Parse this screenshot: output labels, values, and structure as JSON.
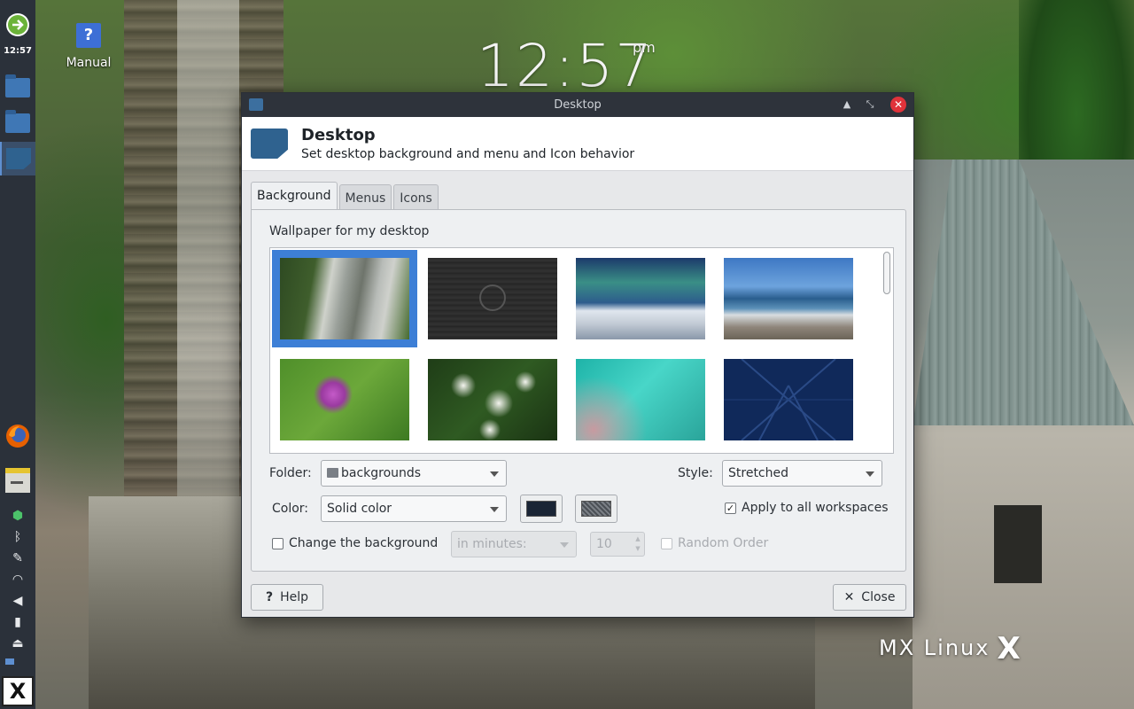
{
  "desktop": {
    "clock_time": "12:57",
    "clock_ampm": "pm",
    "icon_label": "Manual",
    "icon_glyph": "?",
    "watermark": "MX Linux",
    "watermark_mark": "X"
  },
  "panel": {
    "time": "12:57",
    "start_button": "X"
  },
  "window": {
    "title": "Desktop",
    "header_title": "Desktop",
    "header_subtitle": "Set desktop background and menu and Icon behavior",
    "tabs": [
      {
        "label": "Background",
        "active": true
      },
      {
        "label": "Menus",
        "active": false
      },
      {
        "label": "Icons",
        "active": false
      }
    ],
    "section_label": "Wallpaper for my desktop",
    "wallpapers": [
      {
        "name": "waterfall-mill",
        "selected": true
      },
      {
        "name": "dark-mx-logo",
        "selected": false
      },
      {
        "name": "aurora-mountain",
        "selected": false
      },
      {
        "name": "coast-beach",
        "selected": false
      },
      {
        "name": "bee-thistle",
        "selected": false
      },
      {
        "name": "white-flowers",
        "selected": false
      },
      {
        "name": "dew-dandelion",
        "selected": false
      },
      {
        "name": "blue-mx-pattern",
        "selected": false
      }
    ],
    "folder_label": "Folder:",
    "folder_value": "backgrounds",
    "style_label": "Style:",
    "style_value": "Stretched",
    "color_label": "Color:",
    "color_value": "Solid color",
    "primary_color": "#1a2535",
    "secondary_color": "#555a60",
    "apply_all_label": "Apply to all workspaces",
    "apply_all_checked": true,
    "change_bg_label": "Change the background",
    "change_bg_checked": false,
    "interval_value": "in minutes:",
    "interval_number": "10",
    "random_order_label": "Random Order",
    "help_label": "Help",
    "help_icon": "?",
    "close_label": "Close",
    "close_icon": "✕"
  },
  "colors": {
    "panel_bg": "#2b313a",
    "titlebar_bg": "#2e333b",
    "close_red": "#e0323a",
    "selection_blue": "#3d7fd6"
  }
}
